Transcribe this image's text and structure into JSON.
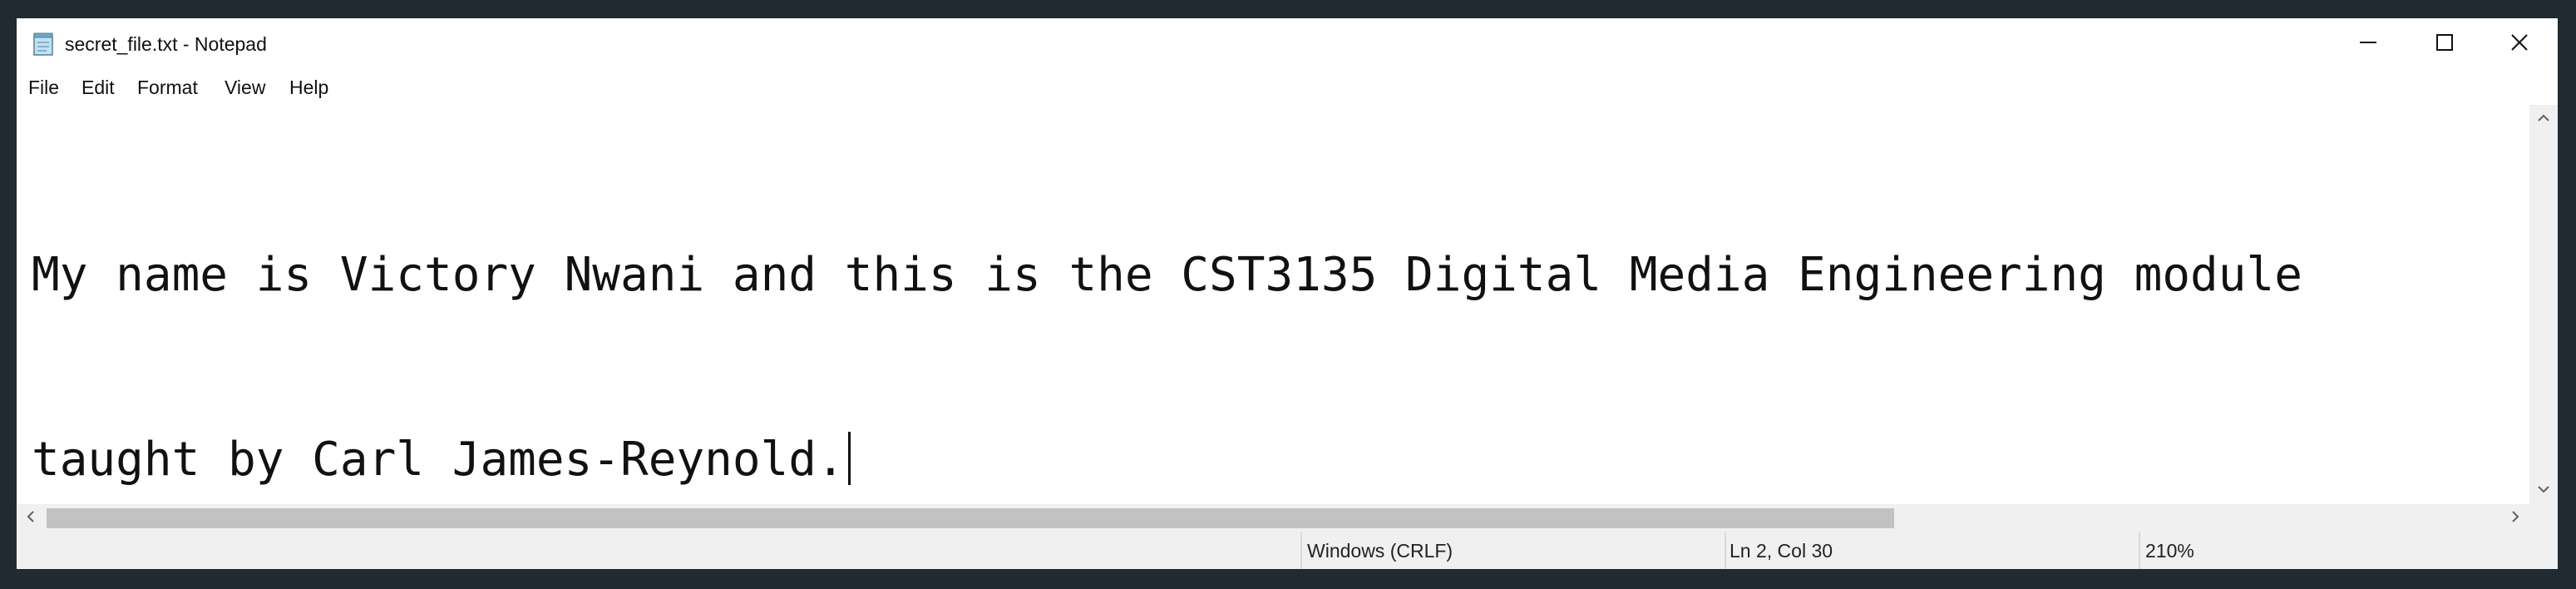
{
  "window": {
    "title": "secret_file.txt - Notepad",
    "app_icon": "notepad-icon",
    "controls": {
      "minimize": "minimize-icon",
      "maximize": "maximize-icon",
      "close": "close-icon"
    }
  },
  "menu": {
    "file": "File",
    "edit": "Edit",
    "format": "Format",
    "view": "View",
    "help": "Help"
  },
  "editor": {
    "lines": [
      "My name is Victory Nwani and this is the CST3135 Digital Media Engineering module",
      "taught by Carl James-Reynold."
    ]
  },
  "scrollbars": {
    "left_arrow": "<",
    "right_arrow": ">",
    "up_arrow": "chevron-up-icon",
    "down_arrow": "chevron-down-icon"
  },
  "status": {
    "line_endings": "Windows (CRLF)",
    "position": "Ln 2, Col 30",
    "zoom": "210%"
  }
}
